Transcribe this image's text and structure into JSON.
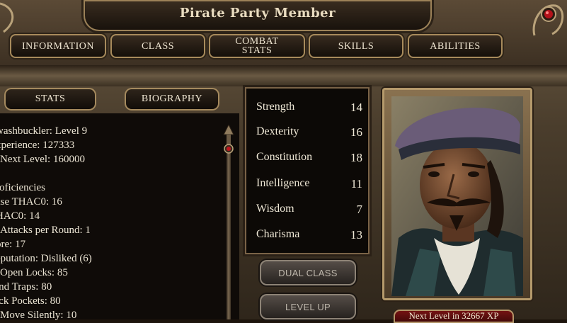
{
  "window": {
    "title": "Pirate Party Member"
  },
  "tabs": [
    {
      "label": "INFORMATION"
    },
    {
      "label_line1": "COMBAT",
      "label_line2": "STATS"
    },
    {
      "label": "CLASS"
    },
    {
      "label": "SKILLS"
    },
    {
      "label": "ABILITIES"
    }
  ],
  "tabs_named": {
    "information": "INFORMATION",
    "class": "CLASS",
    "combat_line1": "COMBAT",
    "combat_line2": "STATS",
    "skills": "SKILLS",
    "abilities": "ABILITIES"
  },
  "subtabs": {
    "stats": "STATS",
    "biography": "BIOGRAPHY"
  },
  "info": {
    "class_level": "washbuckler: Level 9",
    "experience": "xperience: 127333",
    "next_level": "Next Level: 160000",
    "proficiencies": "roficiencies",
    "base_thac0": "ase THAC0: 16",
    "thac0": "HAC0: 14",
    "attacks": "Attacks per Round: 1",
    "lore": "ore: 17",
    "reputation": "eputation: Disliked (6)",
    "open_locks": "Open Locks: 85",
    "find_traps": "ind Traps: 80",
    "pick_pockets": "ick Pockets: 80",
    "move_silently": "Move Silently: 10"
  },
  "attributes": {
    "strength": {
      "name": "Strength",
      "value": "14"
    },
    "dexterity": {
      "name": "Dexterity",
      "value": "16"
    },
    "constitution": {
      "name": "Constitution",
      "value": "18"
    },
    "intelligence": {
      "name": "Intelligence",
      "value": "11"
    },
    "wisdom": {
      "name": "Wisdom",
      "value": "7"
    },
    "charisma": {
      "name": "Charisma",
      "value": "13"
    }
  },
  "buttons": {
    "dual_class": "DUAL CLASS",
    "level_up": "LEVEL UP"
  },
  "xp_bar": {
    "text": "Next Level in 32667 XP"
  },
  "colors": {
    "frame_gold": "#a88b5c",
    "xp_red": "#7a1414",
    "panel_bg": "#0f0b08"
  },
  "icons": {
    "corner_gem": "red-gem-icon",
    "scroll_thumb": "scroll-arrow-icon"
  }
}
